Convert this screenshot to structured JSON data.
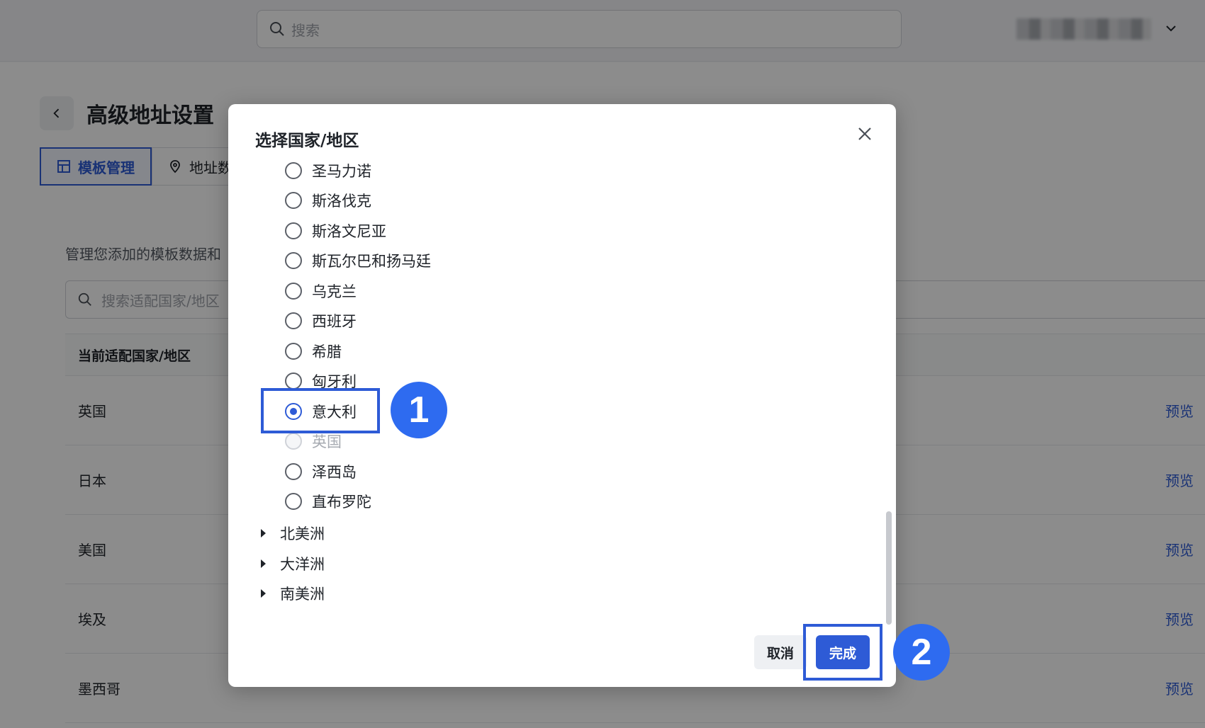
{
  "topbar": {
    "search_placeholder": "搜索"
  },
  "page": {
    "title": "高级地址设置",
    "tabs": [
      {
        "label": "模板管理",
        "active": true
      },
      {
        "label": "地址数"
      }
    ],
    "description": "管理您添加的模板数据和",
    "search_placeholder": "搜索适配国家/地区",
    "table_header": "当前适配国家/地区",
    "rows": [
      {
        "country": "英国",
        "action": "预览"
      },
      {
        "country": "日本",
        "action": "预览"
      },
      {
        "country": "美国",
        "action": "预览"
      },
      {
        "country": "埃及",
        "action": "预览"
      },
      {
        "country": "墨西哥",
        "action": "预览"
      }
    ]
  },
  "modal": {
    "title": "选择国家/地区",
    "countries": [
      {
        "label": "圣马力诺",
        "state": "unchecked"
      },
      {
        "label": "斯洛伐克",
        "state": "unchecked"
      },
      {
        "label": "斯洛文尼亚",
        "state": "unchecked"
      },
      {
        "label": "斯瓦尔巴和扬马廷",
        "state": "unchecked"
      },
      {
        "label": "乌克兰",
        "state": "unchecked"
      },
      {
        "label": "西班牙",
        "state": "unchecked"
      },
      {
        "label": "希腊",
        "state": "unchecked"
      },
      {
        "label": "匈牙利",
        "state": "unchecked"
      },
      {
        "label": "意大利",
        "state": "checked"
      },
      {
        "label": "英国",
        "state": "disabled"
      },
      {
        "label": "泽西岛",
        "state": "unchecked"
      },
      {
        "label": "直布罗陀",
        "state": "unchecked"
      }
    ],
    "regions": [
      {
        "label": "北美洲"
      },
      {
        "label": "大洋洲"
      },
      {
        "label": "南美洲"
      }
    ],
    "cancel_label": "取消",
    "done_label": "完成"
  },
  "annotations": {
    "step1": "1",
    "step2": "2"
  },
  "colors": {
    "accent": "#2e5bd6",
    "marker": "#2e6bf0",
    "overlay": "rgba(0,0,0,0.45)"
  }
}
